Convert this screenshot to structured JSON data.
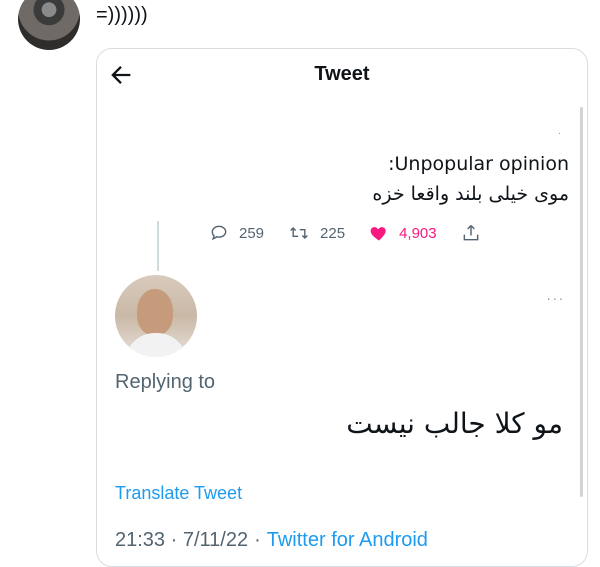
{
  "post": {
    "text": "=))))))"
  },
  "tweet_card": {
    "header_title": "Tweet",
    "quoted_line1": ":Unpopular opinion",
    "quoted_line2": "موی خیلی بلند واقعا خزه",
    "actions": {
      "replies": "259",
      "retweets": "225",
      "likes": "4,903"
    },
    "replying_to": "Replying to",
    "reply_text": "مو کلا جالب نیست",
    "translate_label": "Translate Tweet",
    "timestamp": "21:33 · 7/11/22",
    "separator": "·",
    "client": "Twitter for Android"
  },
  "icons": {
    "back": "arrow-left-icon",
    "reply": "comment-icon",
    "retweet": "retweet-icon",
    "like": "heart-icon",
    "share": "share-icon"
  },
  "colors": {
    "accent": "#1d9bf0",
    "like": "#f91880",
    "muted": "#536471"
  }
}
